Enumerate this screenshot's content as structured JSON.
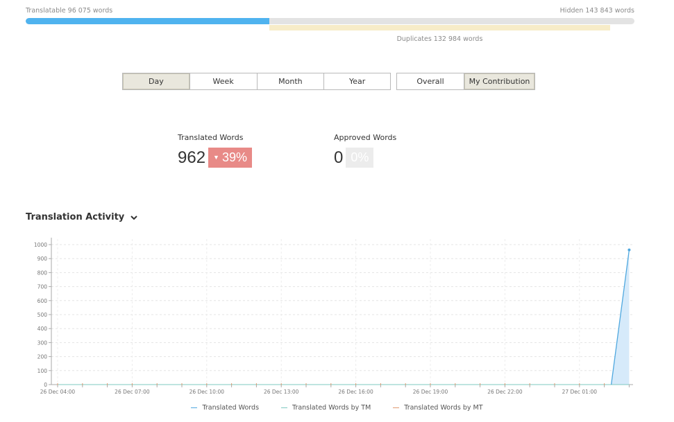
{
  "stats_bar": {
    "translatable_label": "Translatable 96 075 words",
    "hidden_label": "Hidden 143 843 words",
    "duplicates_label": "Duplicates 132 984 words",
    "translatable_fraction": 0.4
  },
  "period_buttons": [
    {
      "label": "Day",
      "active": true
    },
    {
      "label": "Week",
      "active": false
    },
    {
      "label": "Month",
      "active": false
    },
    {
      "label": "Year",
      "active": false
    }
  ],
  "scope_buttons": [
    {
      "label": "Overall",
      "active": false
    },
    {
      "label": "My Contribution",
      "active": true
    }
  ],
  "translated": {
    "label": "Translated Words",
    "value": "962",
    "change": "39%",
    "change_direction": "down",
    "change_color": "#e88a87"
  },
  "approved": {
    "label": "Approved Words",
    "value": "0",
    "change": "0%"
  },
  "activity": {
    "title": "Translation Activity",
    "toggle_icon": "chevron-down-icon"
  },
  "chart_data": {
    "type": "area",
    "x_tick_labels": [
      "26 Dec 04:00",
      "26 Dec 07:00",
      "26 Dec 10:00",
      "26 Dec 13:00",
      "26 Dec 16:00",
      "26 Dec 19:00",
      "26 Dec 22:00",
      "27 Dec 01:00"
    ],
    "y_ticks": [
      0,
      100,
      200,
      300,
      400,
      500,
      600,
      700,
      800,
      900,
      1000
    ],
    "ylim": [
      0,
      1000
    ],
    "x_hours": [
      4,
      5,
      6,
      7,
      8,
      9,
      10,
      11,
      12,
      13,
      14,
      15,
      16,
      17,
      18,
      19,
      20,
      21,
      22,
      23,
      24,
      25,
      26,
      27
    ],
    "series": [
      {
        "name": "Translated Words",
        "color": "#4fa8df",
        "fill": "#d6eafa",
        "values": [
          0,
          0,
          0,
          0,
          0,
          0,
          0,
          0,
          0,
          0,
          0,
          0,
          0,
          0,
          0,
          0,
          0,
          0,
          0,
          0,
          0,
          0,
          0,
          962
        ]
      },
      {
        "name": "Translated Words by TM",
        "color": "#7ec8c0",
        "values": [
          0,
          0,
          0,
          0,
          0,
          0,
          0,
          0,
          0,
          0,
          0,
          0,
          0,
          0,
          0,
          0,
          0,
          0,
          0,
          0,
          0,
          0,
          0,
          0
        ]
      },
      {
        "name": "Translated Words by MT",
        "color": "#e09a70",
        "values": [
          0,
          0,
          0,
          0,
          0,
          0,
          0,
          0,
          0,
          0,
          0,
          0,
          0,
          0,
          0,
          0,
          0,
          0,
          0,
          0,
          0,
          0,
          0,
          0
        ]
      }
    ],
    "grid": true,
    "legend_position": "bottom"
  }
}
